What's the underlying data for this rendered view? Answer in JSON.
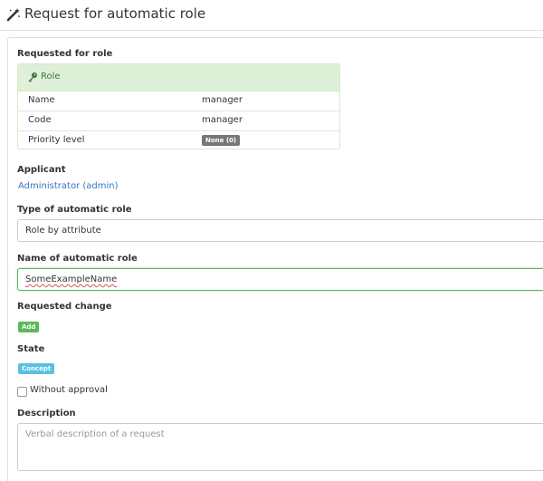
{
  "header": {
    "title": "Request for automatic role"
  },
  "requested_role": {
    "label": "Requested for role",
    "panel_title": "Role",
    "rows": [
      {
        "key": "Name",
        "value": "manager"
      },
      {
        "key": "Code",
        "value": "manager"
      },
      {
        "key": "Priority level",
        "value": "None (0)"
      }
    ]
  },
  "applicant": {
    "label": "Applicant",
    "value": "Administrator (admin)"
  },
  "type": {
    "label": "Type of automatic role",
    "value": "Role by attribute"
  },
  "name": {
    "label": "Name of automatic role",
    "value": "SomeExampleName"
  },
  "change": {
    "label": "Requested change",
    "badge": "Add"
  },
  "state": {
    "label": "State",
    "badge": "Concept"
  },
  "without_approval": {
    "label": "Without approval",
    "checked": false
  },
  "description": {
    "label": "Description",
    "placeholder": "Verbal description of a request"
  },
  "colors": {
    "success": "#5cb85c",
    "info": "#5bc0de",
    "link": "#337ab7",
    "panel_header_bg": "#dff0d8",
    "panel_header_text": "#3c763d",
    "default_badge": "#777777"
  },
  "icons": {
    "title_icon": "magic-wand-icon",
    "role_icon": "key-icon"
  }
}
